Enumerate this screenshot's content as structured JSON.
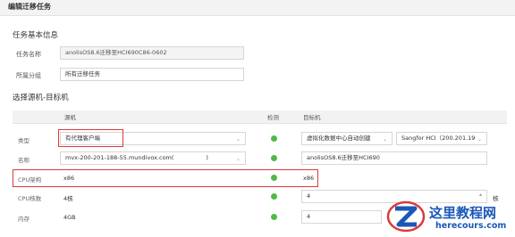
{
  "dialog": {
    "title": "编辑迁移任务"
  },
  "basic_info": {
    "section_title": "任务基本信息",
    "task_name_label": "任务名称",
    "task_name_value": "anolisOS8.6迁移至HCI690C86-0602",
    "group_label": "所属分组",
    "group_value": "所有迁移任务"
  },
  "select": {
    "section_title": "选择源机-目标机",
    "headers": {
      "source": "源机",
      "check": "检测",
      "target": "目标机"
    },
    "rows": {
      "type": {
        "label": "类型",
        "source": "有代理客户端",
        "target": "虚拟化数据中心自动创建",
        "target_platform": "Sangfor HCI（200.201.19"
      },
      "name": {
        "label": "名称",
        "source": "mvx-200-201-188-55.mundivox.com(",
        "source_suffix": ")",
        "target": "anolisOS8.6迁移至HCI690"
      },
      "cpu_arch": {
        "label": "CPU架构",
        "source": "x86",
        "target": "x86"
      },
      "cpu_cores": {
        "label": "CPU核数",
        "source": "4核",
        "target": "4",
        "unit": "核"
      },
      "memory": {
        "label": "内存",
        "source": "4GB",
        "target": "4"
      }
    }
  },
  "watermark": {
    "text": "这里教程网",
    "domain": "herecours.com"
  },
  "colors": {
    "ok_status": "#52b848",
    "highlight_border": "#d93b3b",
    "watermark": "#1a57b8"
  }
}
